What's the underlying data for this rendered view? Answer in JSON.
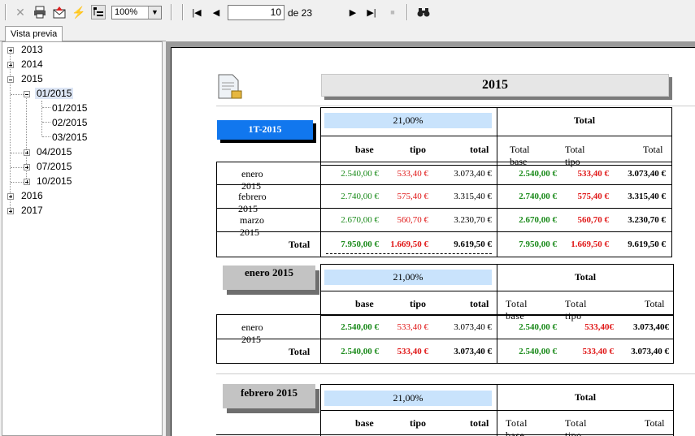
{
  "toolbar": {
    "zoom": "100%",
    "page_current": "10",
    "page_total_label": "de 23"
  },
  "sidebar": {
    "tab": "Vista previa",
    "years": [
      "2013",
      "2014",
      "2015",
      "2016",
      "2017"
    ],
    "quarters": [
      "01/2015",
      "04/2015",
      "07/2015",
      "10/2015"
    ],
    "months": [
      "01/2015",
      "02/2015",
      "03/2015"
    ]
  },
  "report": {
    "year": "2015",
    "q_title": "1T-2015",
    "rate": "21,00%",
    "total": "Total",
    "h_base": "base",
    "h_tipo": "tipo",
    "h_total": "total",
    "h_tbase": "Total base",
    "h_ttipo": "Total tipo",
    "h_ttotal": "Total",
    "row_total": "Total",
    "q_rows": [
      {
        "label": "enero 2015",
        "base": "2.540,00 €",
        "tipo": "533,40 €",
        "total": "3.073,40 €",
        "tbase": "2.540,00 €",
        "ttipo": "533,40 €",
        "ttotal": "3.073,40 €"
      },
      {
        "label": "febrero 2015",
        "base": "2.740,00 €",
        "tipo": "575,40 €",
        "total": "3.315,40 €",
        "tbase": "2.740,00 €",
        "ttipo": "575,40 €",
        "ttotal": "3.315,40 €"
      },
      {
        "label": "marzo 2015",
        "base": "2.670,00 €",
        "tipo": "560,70 €",
        "total": "3.230,70 €",
        "tbase": "2.670,00 €",
        "ttipo": "560,70 €",
        "ttotal": "3.230,70 €"
      }
    ],
    "q_sum": {
      "base": "7.950,00 €",
      "tipo": "1.669,50 €",
      "total": "9.619,50 €",
      "tbase": "7.950,00 €",
      "ttipo": "1.669,50 €",
      "ttotal": "9.619,50 €"
    },
    "m1": {
      "title": "enero 2015",
      "row": {
        "label": "enero 2015",
        "base": "2.540,00 €",
        "tipo": "533,40 €",
        "total": "3.073,40 €",
        "tbase": "2.540,00 €",
        "ttipo": "533,40€",
        "ttotal": "3.073,40€"
      },
      "sum": {
        "base": "2.540,00 €",
        "tipo": "533,40 €",
        "total": "3.073,40 €",
        "tbase": "2.540,00 €",
        "ttipo": "533,40 €",
        "ttotal": "3.073,40 €"
      }
    },
    "m2": {
      "title": "febrero 2015"
    }
  },
  "colors": {
    "green": "#1a8a1a",
    "red": "#e01818",
    "blue_tab": "#1177ee",
    "rate_bg": "#c9e3fc"
  }
}
